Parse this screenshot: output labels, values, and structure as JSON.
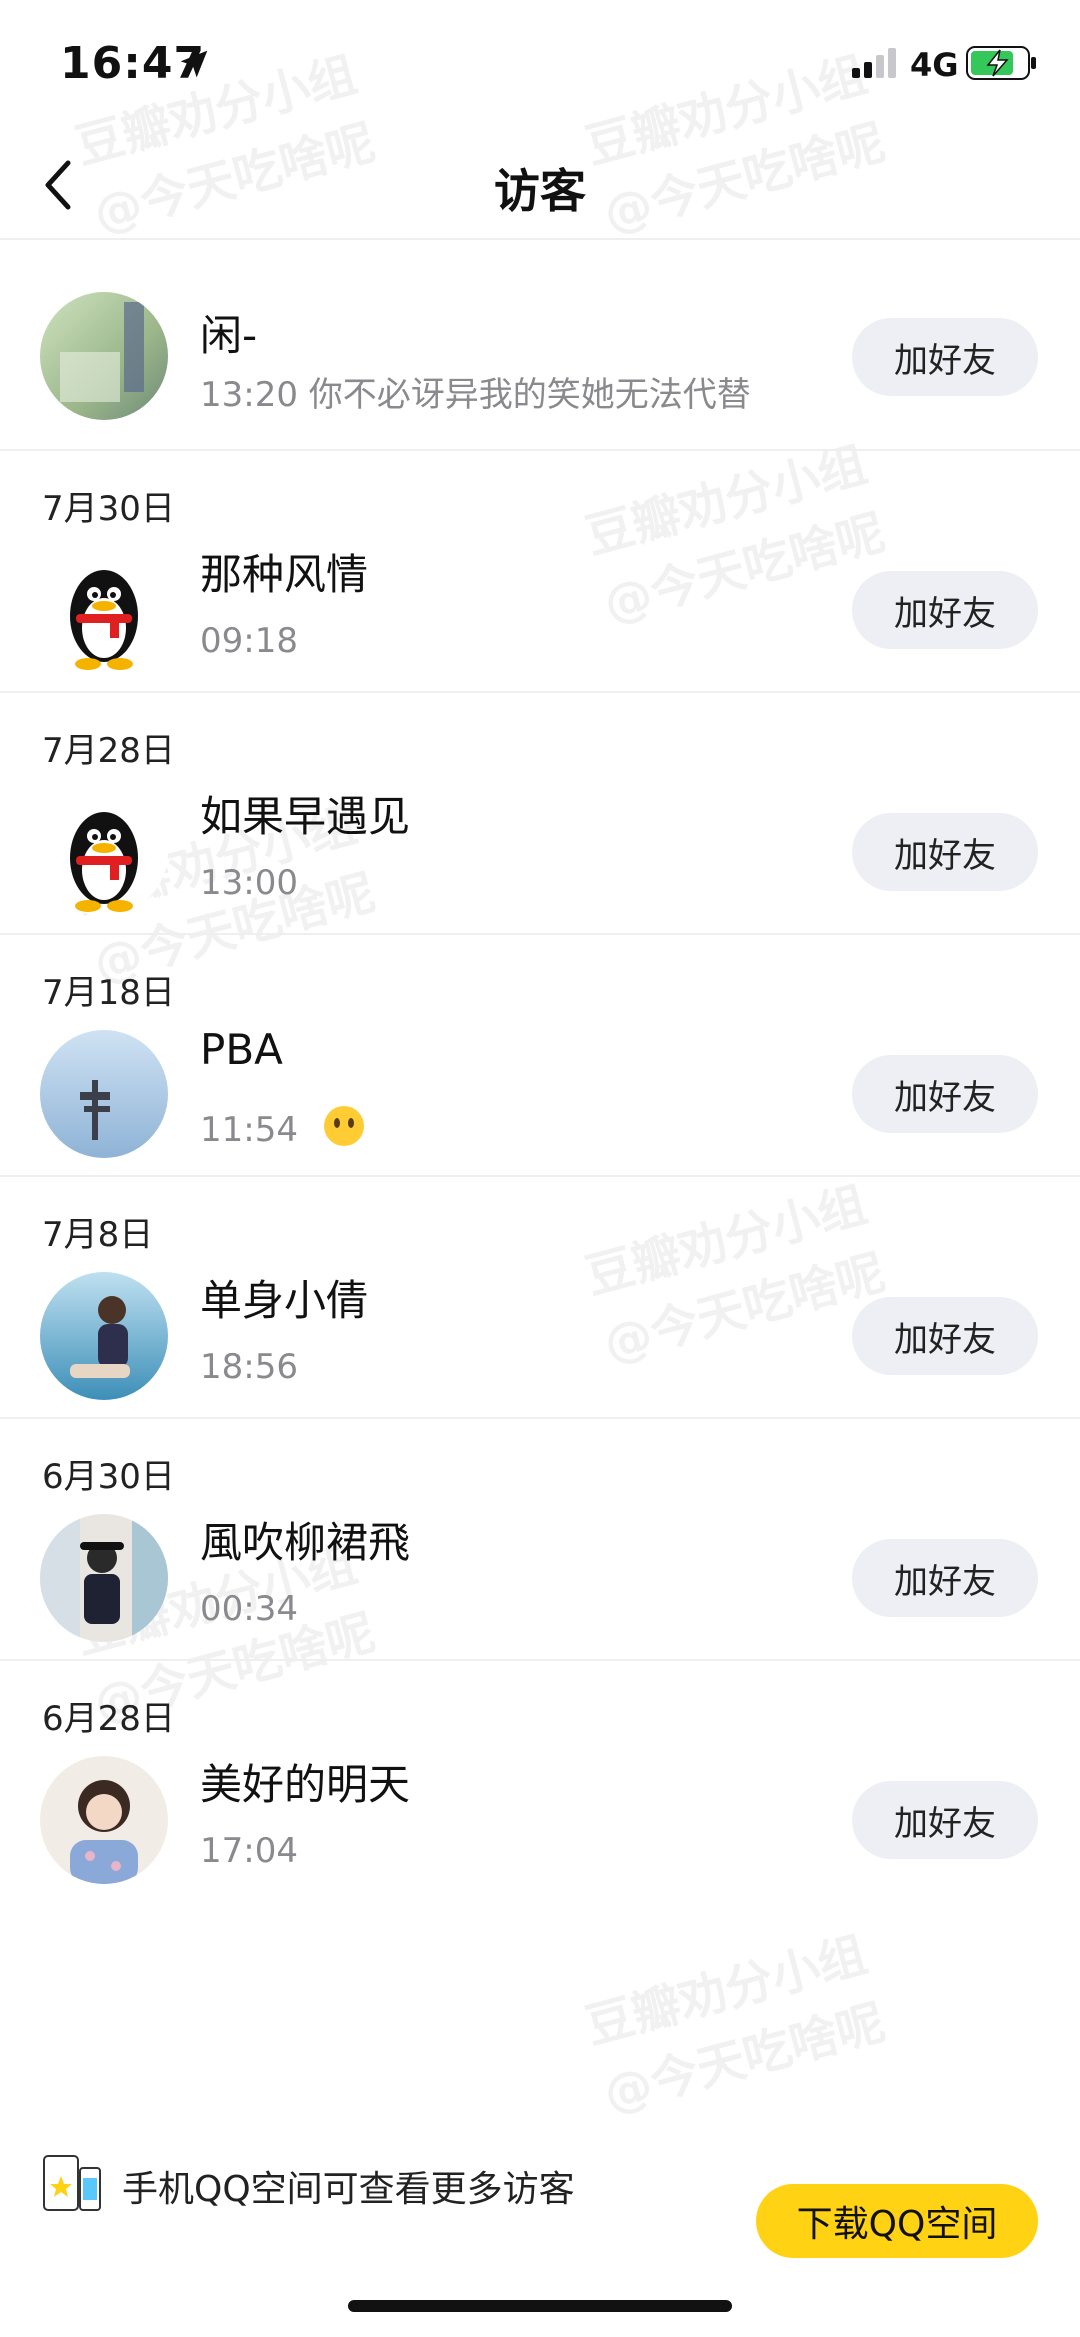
{
  "status_bar": {
    "time": "16:47",
    "network": "4G"
  },
  "nav": {
    "title": "访客"
  },
  "groups": [
    {
      "date": "",
      "visitors": [
        {
          "name": "闲-",
          "time": "13:20",
          "message": "你不必讶异我的笑她无法代替"
        }
      ]
    },
    {
      "date": "7月30日",
      "visitors": [
        {
          "name": "那种风情",
          "time": "09:18"
        }
      ]
    },
    {
      "date": "7月28日",
      "visitors": [
        {
          "name": "如果早遇见",
          "time": "13:00"
        }
      ]
    },
    {
      "date": "7月18日",
      "visitors": [
        {
          "name": "PBA",
          "time": "11:54"
        }
      ]
    },
    {
      "date": "7月8日",
      "visitors": [
        {
          "name": "单身小倩",
          "time": "18:56"
        }
      ]
    },
    {
      "date": "6月30日",
      "visitors": [
        {
          "name": "風吹柳裙飛",
          "time": "00:34"
        }
      ]
    },
    {
      "date": "6月28日",
      "visitors": [
        {
          "name": "美好的明天",
          "time": "17:04"
        }
      ]
    }
  ],
  "add_friend_label": "加好友",
  "promo": {
    "text": "手机QQ空间可查看更多访客",
    "button": "下载QQ空间"
  },
  "watermark": {
    "line1": "豆瓣劝分小组",
    "line2": "@今天吃啥呢"
  },
  "colors": {
    "accent": "#ffd213",
    "button_bg": "#eeeff4",
    "muted": "#8a8a8e"
  }
}
